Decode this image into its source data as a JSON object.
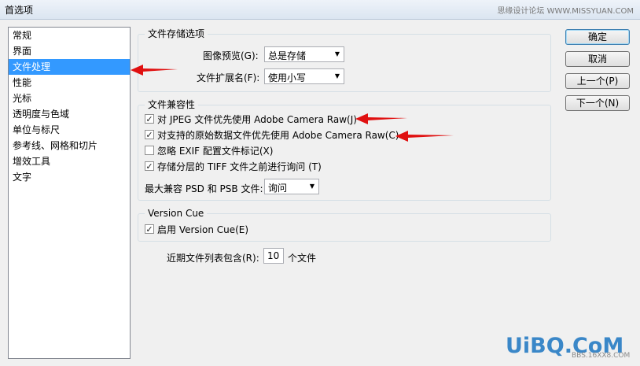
{
  "window": {
    "title": "首选项",
    "watermark_top": "思缘设计论坛 WWW.MISSYUAN.COM"
  },
  "sidebar": {
    "items": [
      {
        "label": "常规"
      },
      {
        "label": "界面"
      },
      {
        "label": "文件处理"
      },
      {
        "label": "性能"
      },
      {
        "label": "光标"
      },
      {
        "label": "透明度与色域"
      },
      {
        "label": "单位与标尺"
      },
      {
        "label": "参考线、网格和切片"
      },
      {
        "label": "增效工具"
      },
      {
        "label": "文字"
      }
    ],
    "selected_index": 2
  },
  "file_save": {
    "title": "文件存储选项",
    "preview_label": "图像预览(G):",
    "preview_value": "总是存储",
    "ext_label": "文件扩展名(F):",
    "ext_value": "使用小写"
  },
  "compat": {
    "title": "文件兼容性",
    "checks": [
      {
        "label": "对 JPEG 文件优先使用 Adobe Camera Raw(J)",
        "checked": true
      },
      {
        "label": "对支持的原始数据文件优先使用 Adobe Camera Raw(C)",
        "checked": true
      },
      {
        "label": "忽略 EXIF 配置文件标记(X)",
        "checked": false
      },
      {
        "label": "存储分层的 TIFF 文件之前进行询问 (T)",
        "checked": true
      }
    ],
    "maximize_label": "最大兼容 PSD 和 PSB 文件:",
    "maximize_value": "询问"
  },
  "version_cue": {
    "title": "Version Cue",
    "enable_label": "启用 Version Cue(E)",
    "enabled": true
  },
  "recent": {
    "label": "近期文件列表包含(R):",
    "value": "10",
    "suffix": "个文件"
  },
  "buttons": {
    "ok": "确定",
    "cancel": "取消",
    "prev": "上一个(P)",
    "next": "下一个(N)"
  },
  "watermark_bottom": {
    "logo": "UiBQ.CoM",
    "sub": "BBS.16XX8.COM"
  },
  "colors": {
    "selection": "#3399ff",
    "arrow": "#e01010"
  }
}
